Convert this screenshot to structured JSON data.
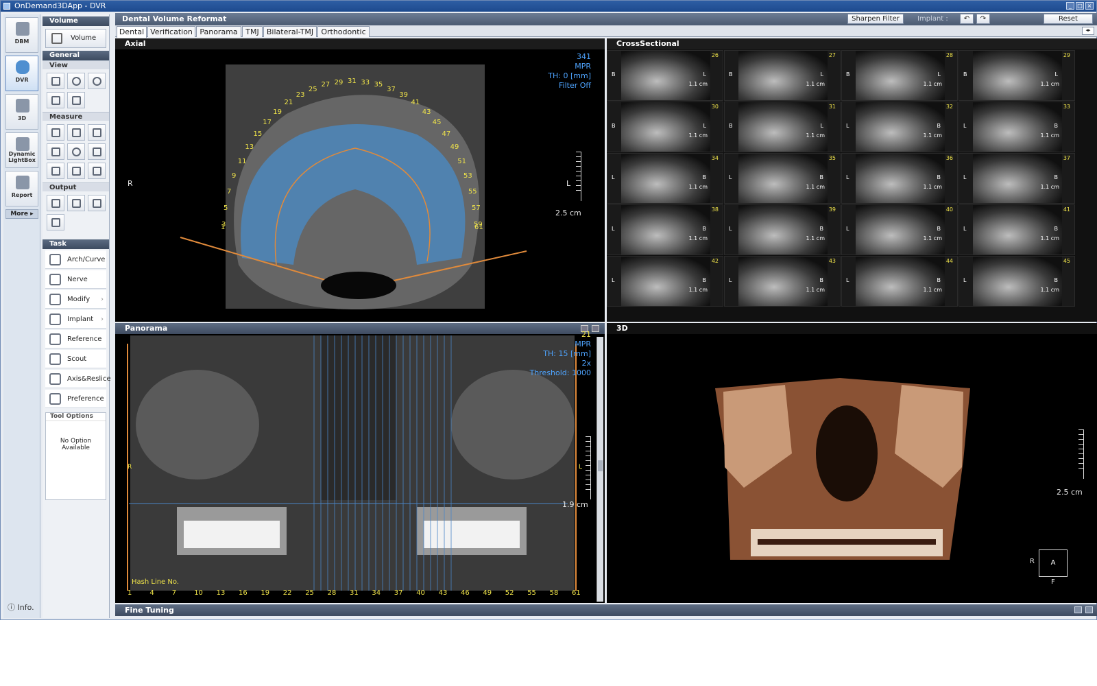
{
  "window": {
    "title": "OnDemand3DApp - DVR"
  },
  "modules": [
    {
      "label": "DBM"
    },
    {
      "label": "DVR"
    },
    {
      "label": "3D"
    },
    {
      "label": "Dynamic LightBox"
    },
    {
      "label": "Report"
    }
  ],
  "more_label": "More",
  "info_label": "Info.",
  "tools": {
    "volume_header": "Volume",
    "volume_button": "Volume",
    "general_header": "General",
    "view_header": "View",
    "measure_header": "Measure",
    "output_header": "Output",
    "task_header": "Task",
    "tasks": [
      "Arch/Curve",
      "Nerve",
      "Modify",
      "Implant",
      "Reference",
      "Scout",
      "Axis&Reslice",
      "Preference"
    ],
    "tool_options_header": "Tool Options",
    "tool_options_body": "No Option Available"
  },
  "header": {
    "title": "Dental Volume Reformat",
    "sharpen_filter": "Sharpen Filter",
    "implant_label": "Implant :",
    "reset": "Reset"
  },
  "tabs": [
    "Dental",
    "Verification",
    "Panorama",
    "TMJ",
    "Bilateral-TMJ",
    "Orthodontic"
  ],
  "axial": {
    "title": "Axial",
    "overlay": [
      "341",
      "MPR",
      "TH: 0 [mm]",
      "Filter Off"
    ],
    "left_marker": "R",
    "right_marker": "L",
    "scale_label": "2.5 cm",
    "numbers": [
      "1",
      "3",
      "5",
      "7",
      "9",
      "11",
      "13",
      "15",
      "17",
      "19",
      "21",
      "23",
      "25",
      "27",
      "29",
      "31",
      "33",
      "35",
      "37",
      "39",
      "41",
      "43",
      "45",
      "47",
      "49",
      "51",
      "53",
      "55",
      "57",
      "59",
      "61"
    ]
  },
  "crosssectional": {
    "title": "CrossSectional",
    "scale_text": "1.1 cm",
    "cells": [
      {
        "n": "26",
        "l": "B",
        "r": "L"
      },
      {
        "n": "27",
        "l": "B",
        "r": "L"
      },
      {
        "n": "28",
        "l": "B",
        "r": "L"
      },
      {
        "n": "29",
        "l": "B",
        "r": "L"
      },
      {
        "n": "30",
        "l": "B",
        "r": "L"
      },
      {
        "n": "31",
        "l": "B",
        "r": "L"
      },
      {
        "n": "32",
        "l": "L",
        "r": "B"
      },
      {
        "n": "33",
        "l": "L",
        "r": "B"
      },
      {
        "n": "34",
        "l": "L",
        "r": "B"
      },
      {
        "n": "35",
        "l": "L",
        "r": "B"
      },
      {
        "n": "36",
        "l": "L",
        "r": "B"
      },
      {
        "n": "37",
        "l": "L",
        "r": "B"
      },
      {
        "n": "38",
        "l": "L",
        "r": "B"
      },
      {
        "n": "39",
        "l": "L",
        "r": "B"
      },
      {
        "n": "40",
        "l": "L",
        "r": "B"
      },
      {
        "n": "41",
        "l": "L",
        "r": "B"
      },
      {
        "n": "42",
        "l": "L",
        "r": "B"
      },
      {
        "n": "43",
        "l": "L",
        "r": "B"
      },
      {
        "n": "44",
        "l": "L",
        "r": "B"
      },
      {
        "n": "45",
        "l": "L",
        "r": "B"
      }
    ]
  },
  "panorama": {
    "title": "Panorama",
    "overlay": [
      "21",
      "MPR",
      "TH: 15 [mm]",
      "2x",
      "Threshold: 1000"
    ],
    "left_marker": "R",
    "right_marker": "L",
    "scale_label": "1.9 cm",
    "hash_label": "Hash Line No.",
    "hash_numbers": [
      "1",
      "4",
      "7",
      "10",
      "13",
      "16",
      "19",
      "22",
      "25",
      "28",
      "31",
      "34",
      "37",
      "40",
      "43",
      "46",
      "49",
      "52",
      "55",
      "58",
      "61"
    ]
  },
  "view3d": {
    "title": "3D",
    "scale_label": "2.5 cm",
    "orient_r": "R",
    "orient_a": "A",
    "orient_f": "F"
  },
  "fine_tuning": {
    "title": "Fine Tuning"
  }
}
